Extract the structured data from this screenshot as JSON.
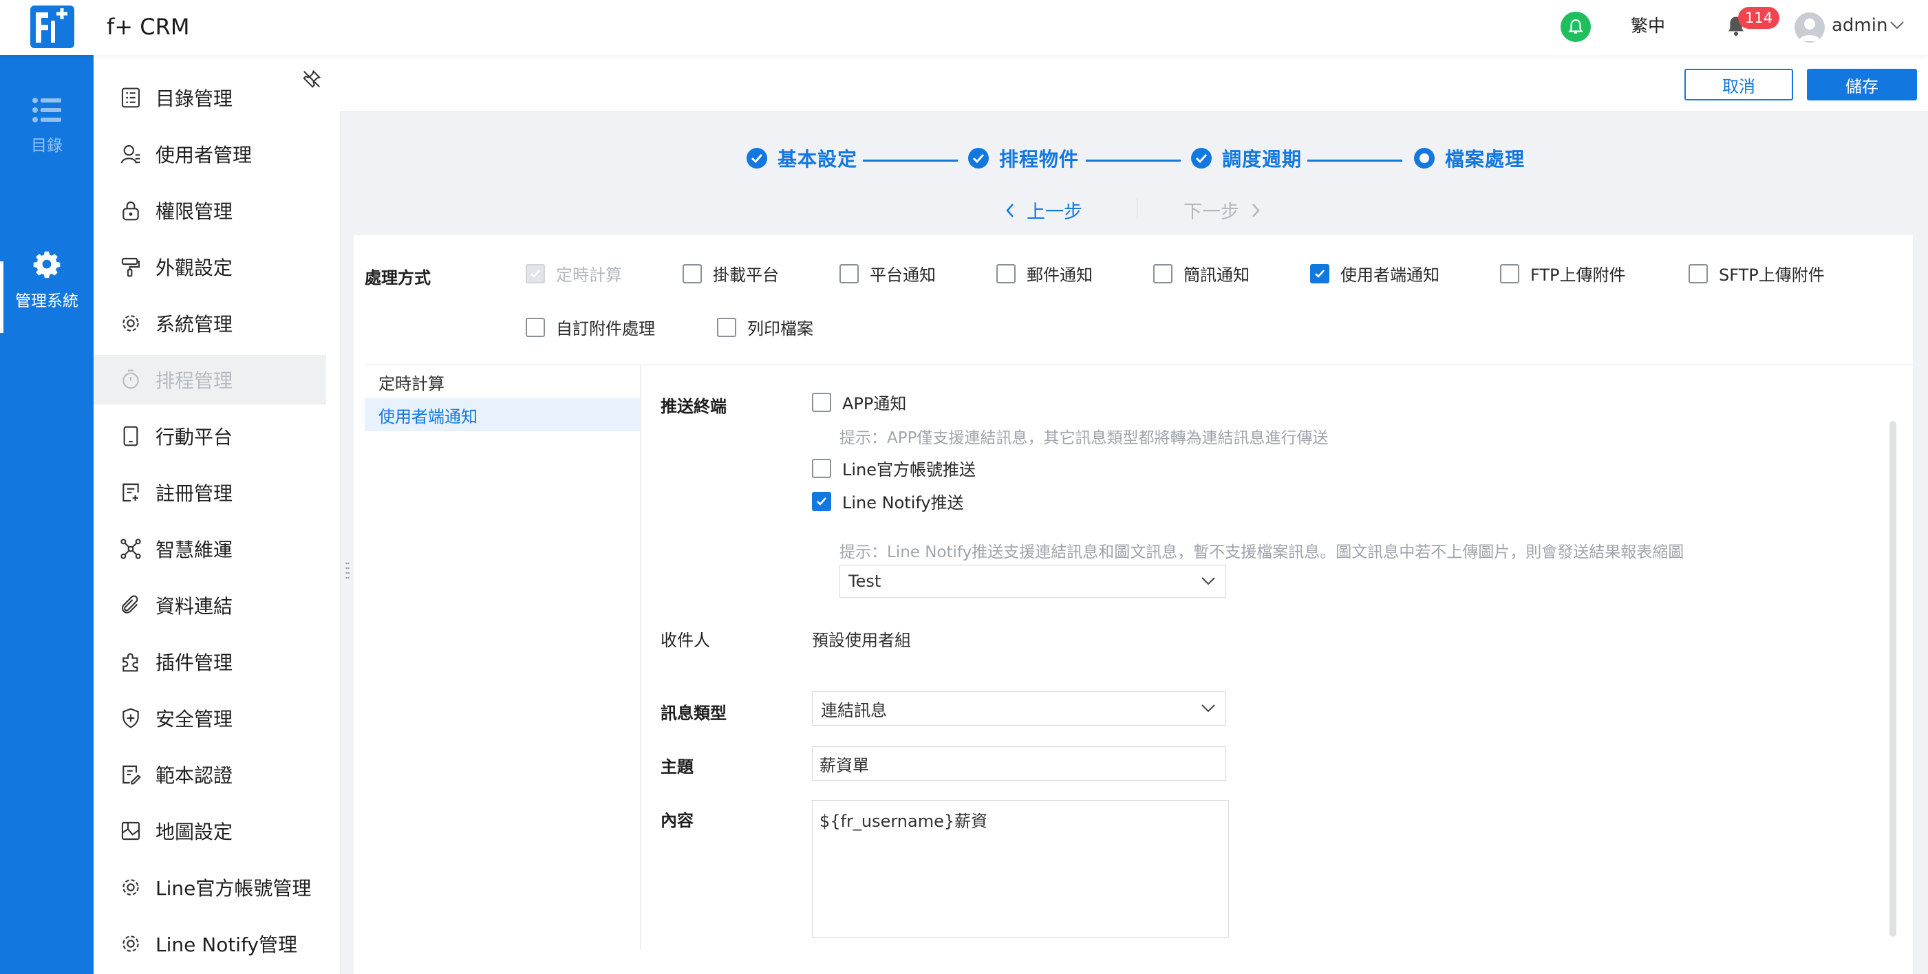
{
  "app": {
    "title": "f+ CRM",
    "language": "繁中",
    "notification_count": "114",
    "user": "admin",
    "colors": {
      "primary": "#1277de",
      "rail": "#1277de",
      "badge": "#f0454f",
      "online": "#1fbf5f"
    }
  },
  "rail": {
    "items": [
      {
        "label": "目錄",
        "icon": "list-icon"
      },
      {
        "label": "管理系統",
        "icon": "gear-icon"
      }
    ]
  },
  "menu": {
    "items": [
      {
        "label": "目錄管理",
        "icon": "directory-icon"
      },
      {
        "label": "使用者管理",
        "icon": "user-icon"
      },
      {
        "label": "權限管理",
        "icon": "lock-icon"
      },
      {
        "label": "外觀設定",
        "icon": "paint-roller-icon"
      },
      {
        "label": "系統管理",
        "icon": "gear-icon"
      },
      {
        "label": "排程管理",
        "icon": "timer-icon",
        "active": true
      },
      {
        "label": "行動平台",
        "icon": "tablet-icon"
      },
      {
        "label": "註冊管理",
        "icon": "register-icon"
      },
      {
        "label": "智慧維運",
        "icon": "network-icon"
      },
      {
        "label": "資料連結",
        "icon": "paperclip-icon"
      },
      {
        "label": "插件管理",
        "icon": "puzzle-icon"
      },
      {
        "label": "安全管理",
        "icon": "shield-icon"
      },
      {
        "label": "範本認證",
        "icon": "certificate-icon"
      },
      {
        "label": "地圖設定",
        "icon": "map-icon"
      },
      {
        "label": "Line官方帳號管理",
        "icon": "gear-icon"
      },
      {
        "label": "Line Notify管理",
        "icon": "gear-icon"
      }
    ]
  },
  "toolbar": {
    "cancel_label": "取消",
    "save_label": "儲存"
  },
  "steps": {
    "items": [
      "基本設定",
      "排程物件",
      "調度週期",
      "檔案處理"
    ],
    "current": 3,
    "prev_label": "上一步",
    "next_label": "下一步"
  },
  "processing": {
    "label": "處理方式",
    "options": [
      {
        "label": "定時計算",
        "checked": true,
        "disabled": true
      },
      {
        "label": "掛載平台",
        "checked": false
      },
      {
        "label": "平台通知",
        "checked": false
      },
      {
        "label": "郵件通知",
        "checked": false
      },
      {
        "label": "簡訊通知",
        "checked": false
      },
      {
        "label": "使用者端通知",
        "checked": true
      },
      {
        "label": "FTP上傳附件",
        "checked": false
      },
      {
        "label": "SFTP上傳附件",
        "checked": false
      },
      {
        "label": "自訂附件處理",
        "checked": false
      },
      {
        "label": "列印檔案",
        "checked": false
      }
    ]
  },
  "subnav": {
    "items": [
      "定時計算",
      "使用者端通知"
    ],
    "active": 1
  },
  "form": {
    "push_label": "推送終端",
    "app_notify": "APP通知",
    "app_hint": "提示：APP僅支援連結訊息，其它訊息類型都將轉為連結訊息進行傳送",
    "line_official": "Line官方帳號推送",
    "line_notify": "Line Notify推送",
    "line_hint": "提示：Line Notify推送支援連結訊息和圖文訊息，暫不支援檔案訊息。圖文訊息中若不上傳圖片，則會發送結果報表縮圖",
    "line_select": "Test",
    "recipient_label": "收件人",
    "recipient_value": "預設使用者組",
    "msgtype_label": "訊息類型",
    "msgtype_value": "連結訊息",
    "subject_label": "主題",
    "subject_value": "薪資單",
    "content_label": "內容",
    "content_value": "${fr_username}薪資"
  }
}
